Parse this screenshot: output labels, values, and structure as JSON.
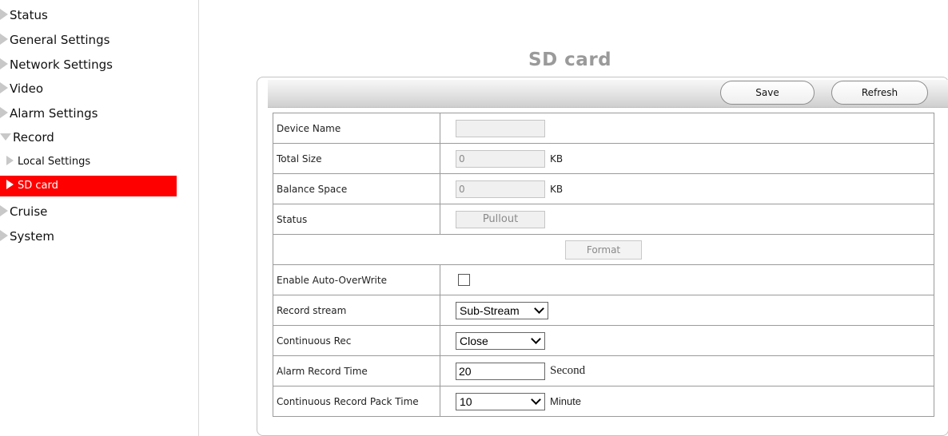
{
  "sidebar": {
    "items": [
      {
        "label": "Status"
      },
      {
        "label": "General Settings"
      },
      {
        "label": "Network Settings"
      },
      {
        "label": "Video"
      },
      {
        "label": "Alarm Settings"
      },
      {
        "label": "Record"
      },
      {
        "label": "Local Settings"
      },
      {
        "label": "SD card"
      },
      {
        "label": "Cruise"
      },
      {
        "label": "System"
      }
    ],
    "active_color": "#ff0000"
  },
  "main": {
    "title": "SD card",
    "toolbar": {
      "save_label": "Save",
      "refresh_label": "Refresh"
    },
    "rows": {
      "device_name": {
        "label": "Device Name",
        "value": ""
      },
      "total_size": {
        "label": "Total Size",
        "value": "0",
        "unit": "KB"
      },
      "balance_space": {
        "label": "Balance Space",
        "value": "0",
        "unit": "KB"
      },
      "status": {
        "label": "Status",
        "value": "Pullout"
      },
      "format": {
        "label": "Format"
      },
      "auto_overwrite": {
        "label": "Enable Auto-OverWrite",
        "checked": false
      },
      "record_stream": {
        "label": "Record stream",
        "value": "Sub-Stream"
      },
      "continuous_rec": {
        "label": "Continuous Rec",
        "value": "Close"
      },
      "alarm_record_time": {
        "label": "Alarm Record Time",
        "value": "20",
        "unit": "Second"
      },
      "pack_time": {
        "label": "Continuous Record Pack Time",
        "value": "10",
        "unit": "Minute"
      }
    }
  },
  "icons": {
    "collapsed": "triangle-right-icon",
    "expanded": "triangle-down-icon",
    "dropdown": "chevron-down-icon"
  }
}
